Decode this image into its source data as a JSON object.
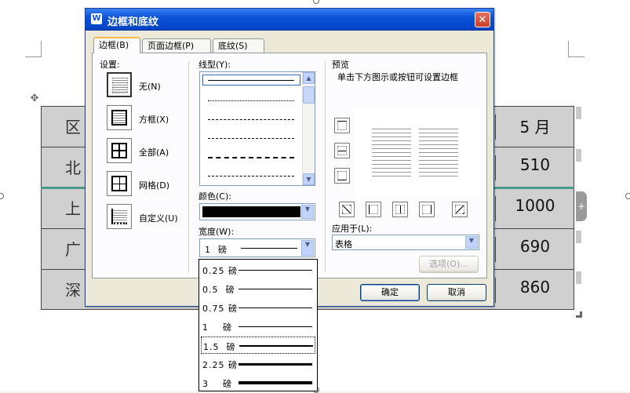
{
  "dialog": {
    "title": "边框和底纹",
    "app_icon": "W",
    "close_glyph": "✕",
    "tabs": [
      {
        "label": "边框(B)"
      },
      {
        "label": "页面边框(P)"
      },
      {
        "label": "底纹(S)"
      }
    ],
    "settings": {
      "label": "设置:",
      "items": [
        {
          "label": "无(N)",
          "icon": "border-none-icon"
        },
        {
          "label": "方框(X)",
          "icon": "border-box-icon"
        },
        {
          "label": "全部(A)",
          "icon": "border-all-icon"
        },
        {
          "label": "网格(D)",
          "icon": "border-grid-icon"
        },
        {
          "label": "自定义(U)",
          "icon": "border-custom-icon"
        }
      ]
    },
    "line_style": {
      "label": "线型(Y):"
    },
    "color": {
      "label": "颜色(C):",
      "value_hex": "#000000"
    },
    "width": {
      "label": "宽度(W):",
      "value": "1  磅"
    },
    "preview": {
      "label": "预览",
      "hint": "单击下方图示或按钮可设置边框"
    },
    "apply_to": {
      "label": "应用于(L):",
      "value": "表格"
    },
    "options_button": "选项(O)...",
    "ok_button": "确定",
    "cancel_button": "取消"
  },
  "width_options": [
    {
      "label": "0.25 磅",
      "points": 0.25
    },
    {
      "label": "0.5  磅",
      "points": 0.5
    },
    {
      "label": "0.75 磅",
      "points": 0.75
    },
    {
      "label": "1    磅",
      "points": 1
    },
    {
      "label": "1.5  磅",
      "points": 1.5,
      "focused": true
    },
    {
      "label": "2.25 磅",
      "points": 2.25
    },
    {
      "label": "3    磅",
      "points": 3
    }
  ],
  "table": {
    "rows": [
      {
        "left": "区",
        "right": "5 月"
      },
      {
        "left": "北",
        "right": "510"
      },
      {
        "left": "上",
        "right": "1000"
      },
      {
        "left": "广",
        "right": "690"
      },
      {
        "left": "深",
        "right": "860"
      }
    ],
    "fill_color": "#d0d0d0"
  }
}
